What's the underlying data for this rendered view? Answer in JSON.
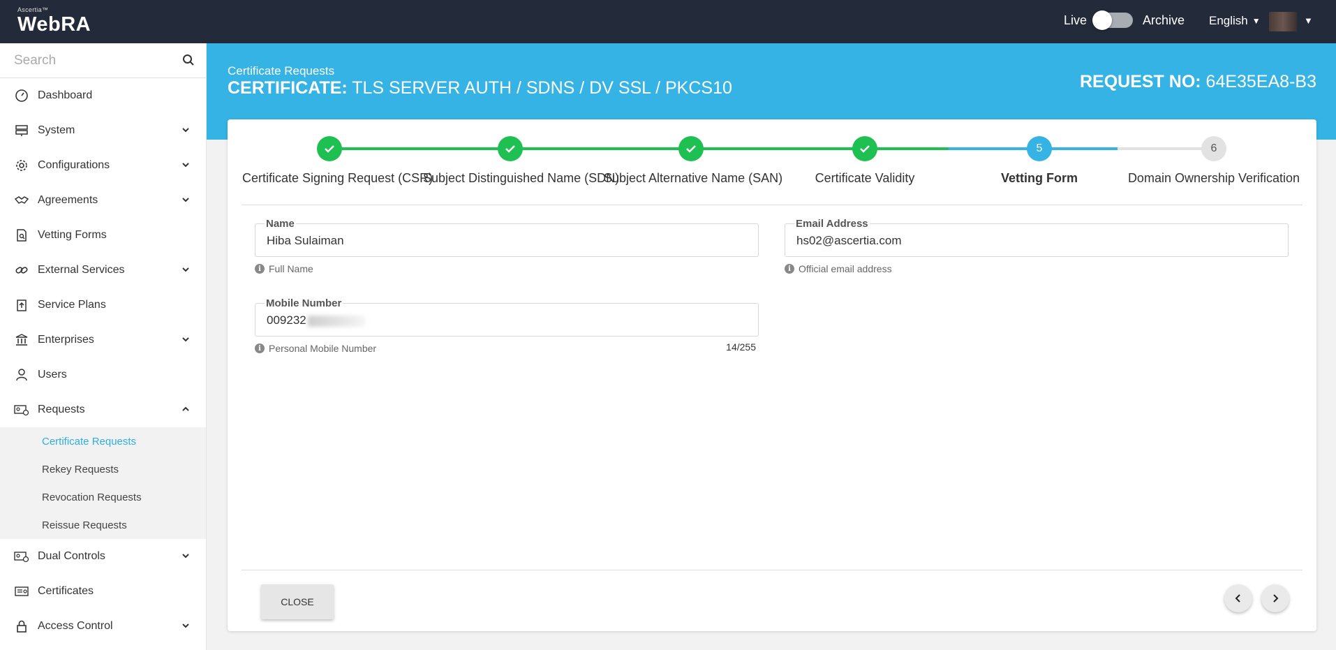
{
  "topbar": {
    "logo_small": "Ascertia™",
    "logo_big": "WebRA",
    "mode_live": "Live",
    "mode_archive": "Archive",
    "language": "English"
  },
  "sidebar": {
    "search_placeholder": "Search",
    "items": [
      {
        "label": "Dashboard",
        "icon": "gauge-icon"
      },
      {
        "label": "System",
        "icon": "server-icon"
      },
      {
        "label": "Configurations",
        "icon": "gear-icon"
      },
      {
        "label": "Agreements",
        "icon": "handshake-icon"
      },
      {
        "label": "Vetting Forms",
        "icon": "document-search-icon"
      },
      {
        "label": "External Services",
        "icon": "link-icon"
      },
      {
        "label": "Service Plans",
        "icon": "upload-doc-icon"
      },
      {
        "label": "Enterprises",
        "icon": "bank-icon"
      },
      {
        "label": "Users",
        "icon": "user-icon"
      },
      {
        "label": "Requests",
        "icon": "id-card-icon"
      },
      {
        "label": "Dual Controls",
        "icon": "id-card-icon"
      },
      {
        "label": "Certificates",
        "icon": "certificate-icon"
      },
      {
        "label": "Access Control",
        "icon": "lock-icon"
      }
    ],
    "requests_sub": [
      "Certificate Requests",
      "Rekey Requests",
      "Revocation Requests",
      "Reissue Requests"
    ]
  },
  "banner": {
    "breadcrumb": "Certificate Requests",
    "title_prefix": "CERTIFICATE:",
    "title_value": "TLS SERVER AUTH / SDNS / DV SSL / PKCS10",
    "reqno_prefix": "REQUEST NO:",
    "reqno_value": "64E35EA8-B3"
  },
  "stepper": {
    "steps": [
      {
        "label": "Certificate Signing Request (CSR)",
        "state": "done"
      },
      {
        "label": "Subject Distinguished Name (SDN)",
        "state": "done"
      },
      {
        "label": "Subject Alternative Name (SAN)",
        "state": "done"
      },
      {
        "label": "Certificate Validity",
        "state": "done"
      },
      {
        "label": "Vetting Form",
        "state": "current",
        "number": "5"
      },
      {
        "label": "Domain Ownership Verification",
        "state": "todo",
        "number": "6"
      }
    ],
    "colors": {
      "done": "#1ec052",
      "current": "#34b3e4",
      "todo": "#e2e2e2"
    }
  },
  "form": {
    "name": {
      "label": "Name",
      "value": "Hiba Sulaiman",
      "hint": "Full Name"
    },
    "email": {
      "label": "Email Address",
      "value": "hs02@ascertia.com",
      "hint": "Official email address"
    },
    "mobile": {
      "label": "Mobile Number",
      "value": "009232",
      "hint": "Personal Mobile Number",
      "counter": "14/255"
    }
  },
  "footer": {
    "close_label": "CLOSE"
  },
  "colors": {
    "topbar": "#232b3a",
    "banner": "#34b3e4",
    "active_link": "#2eaee2"
  }
}
